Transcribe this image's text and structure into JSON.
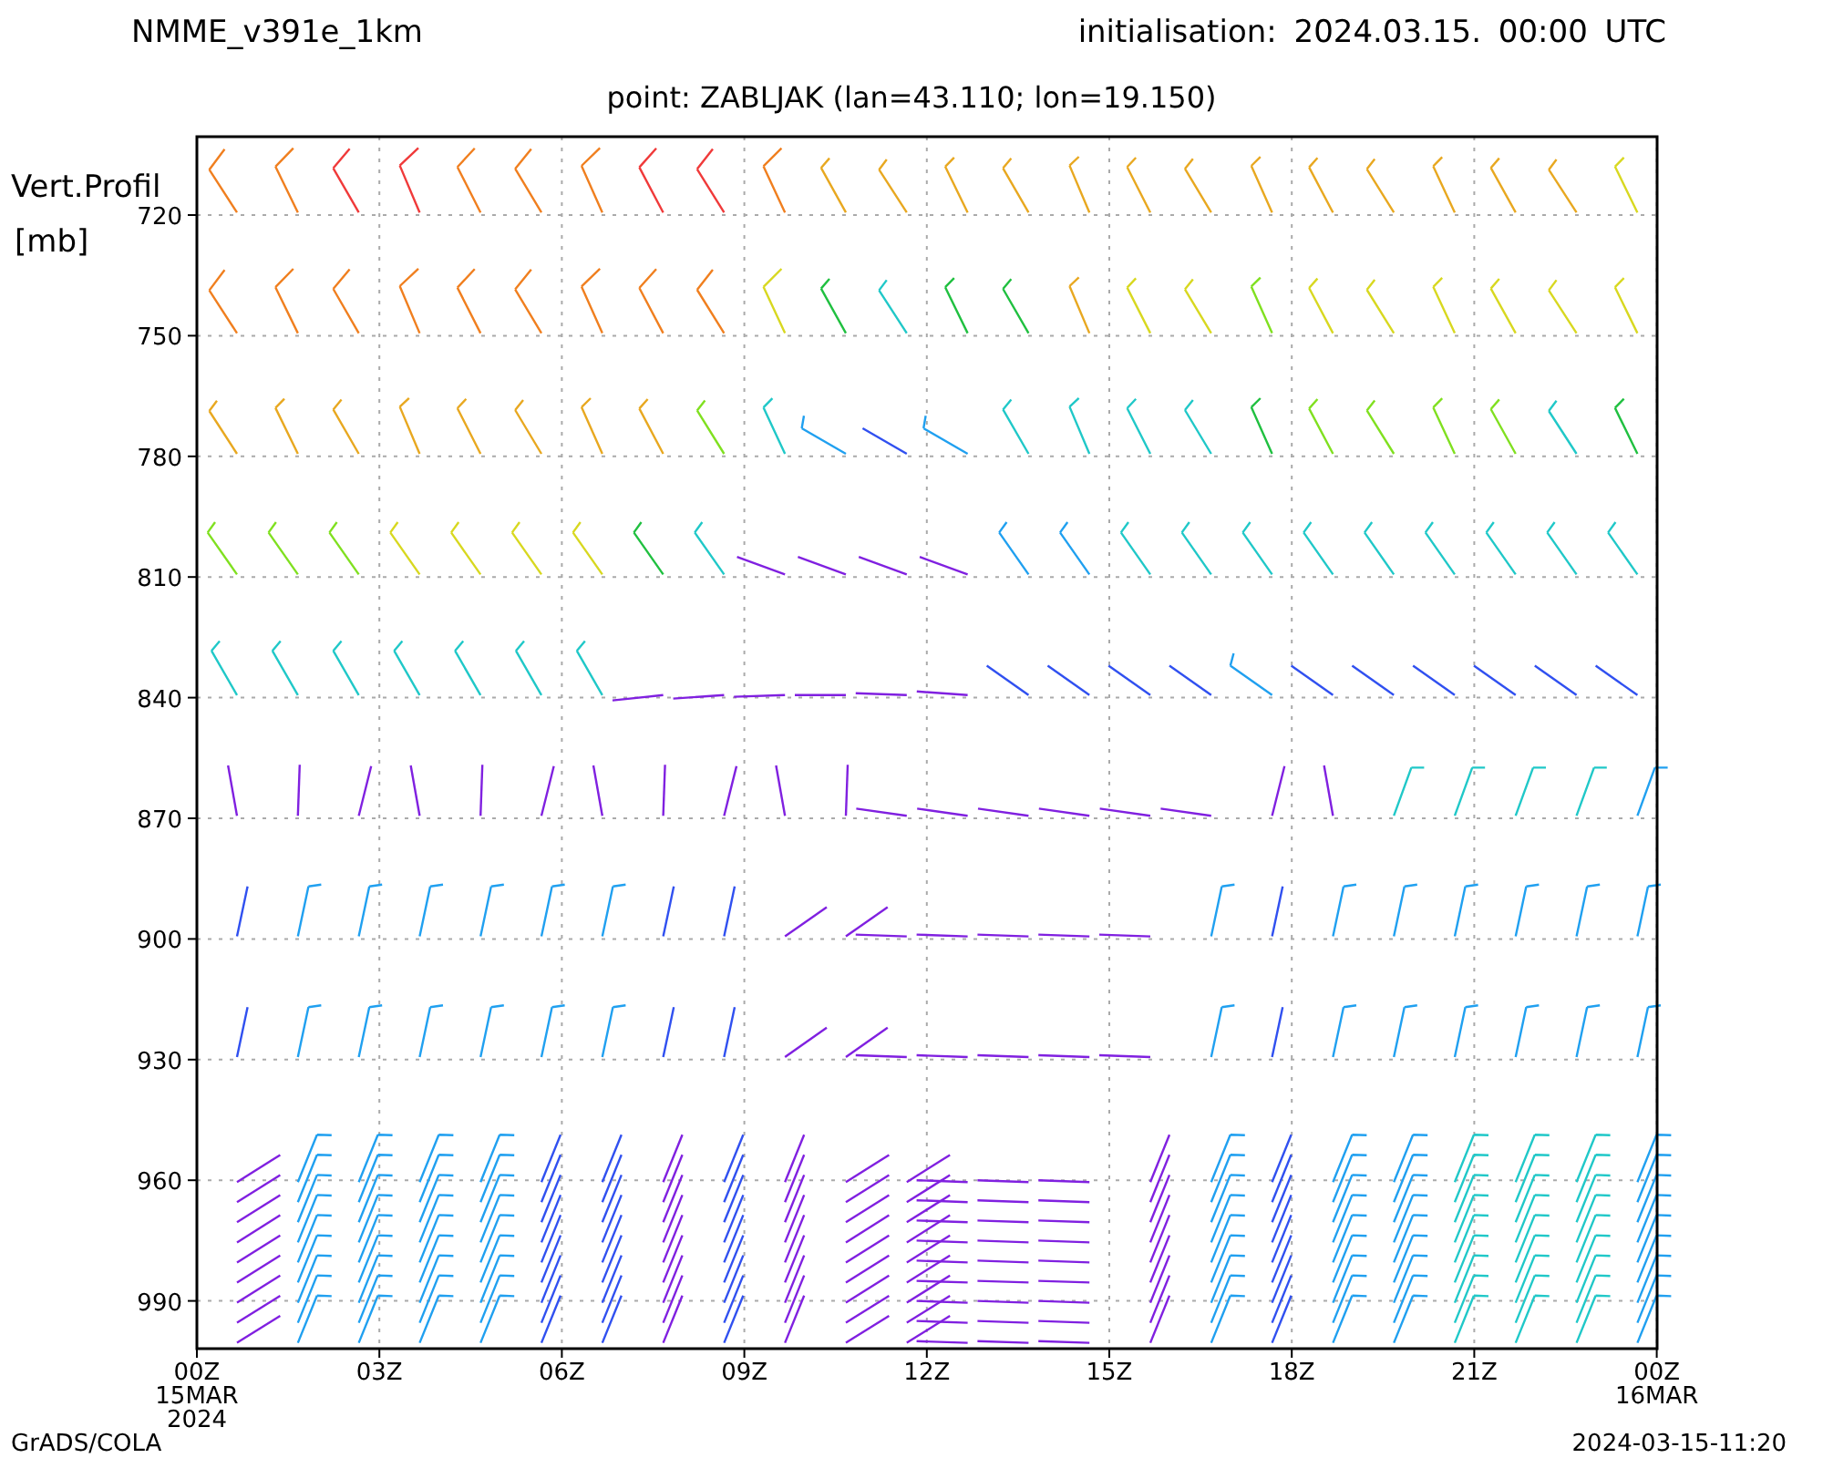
{
  "header": {
    "model": "NMME_v391e_1km",
    "initialisation": "initialisation: 2024.03.15. 00:00 UTC"
  },
  "subtitle": "point: ZABLJAK (lan=43.110; lon=19.150)",
  "plot": {
    "y_label": [
      "Vert.Profil",
      "[mb]"
    ],
    "y_ticks": [
      "720",
      "750",
      "780",
      "810",
      "840",
      "870",
      "900",
      "930",
      "960",
      "990"
    ],
    "x_ticks": [
      {
        "lines": [
          "00Z",
          "15MAR",
          "2024"
        ]
      },
      {
        "lines": [
          "03Z"
        ]
      },
      {
        "lines": [
          "06Z"
        ]
      },
      {
        "lines": [
          "09Z"
        ]
      },
      {
        "lines": [
          "12Z"
        ]
      },
      {
        "lines": [
          "15Z"
        ]
      },
      {
        "lines": [
          "18Z"
        ]
      },
      {
        "lines": [
          "21Z"
        ]
      },
      {
        "lines": [
          "00Z",
          "16MAR"
        ]
      }
    ]
  },
  "footer": {
    "left": "GrADS/COLA",
    "right": "2024-03-15-11:20"
  }
}
